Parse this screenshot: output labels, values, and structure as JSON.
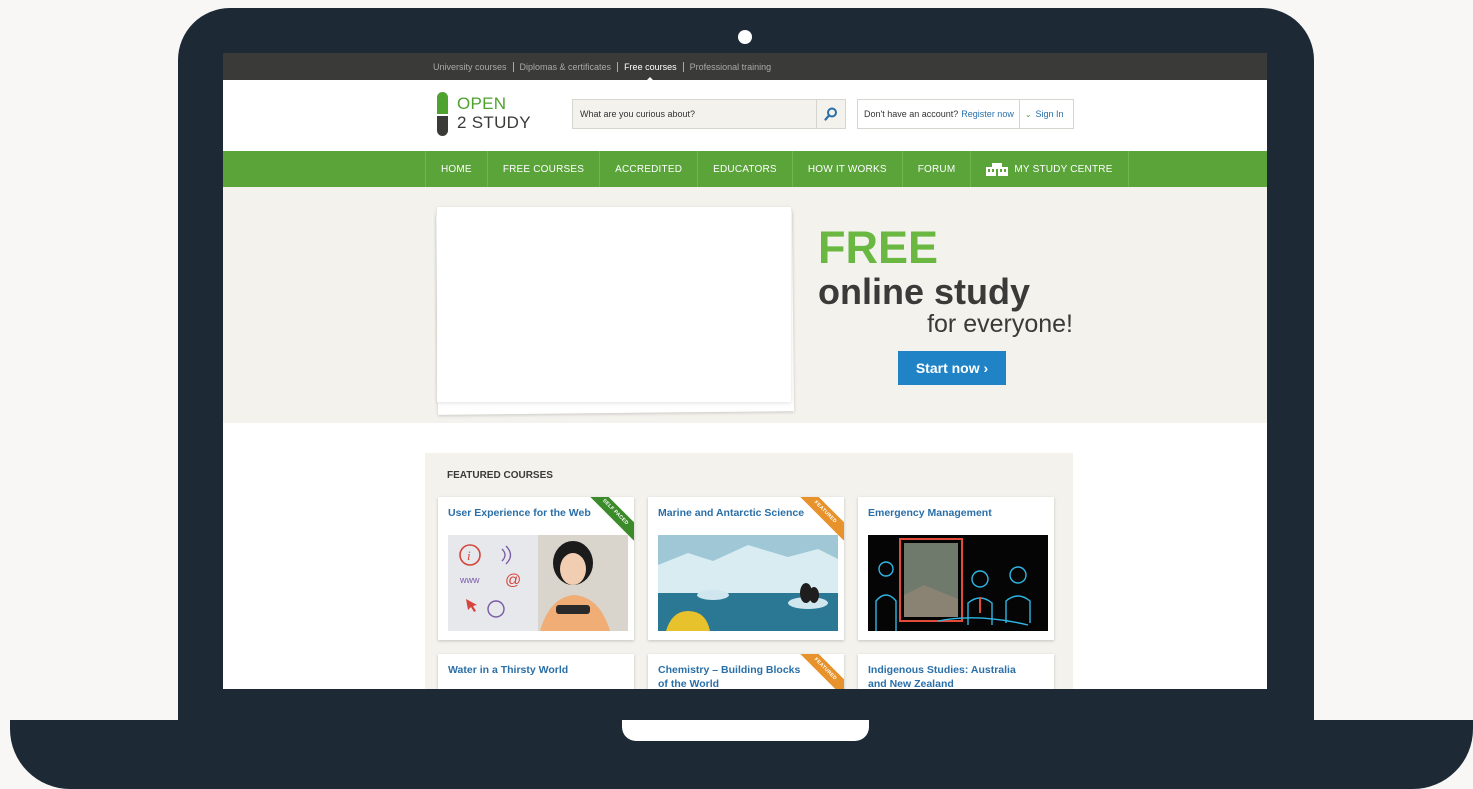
{
  "topbar": {
    "links": [
      {
        "label": "University courses",
        "active": false
      },
      {
        "label": "Diplomas & certificates",
        "active": false
      },
      {
        "label": "Free courses",
        "active": true
      },
      {
        "label": "Professional training",
        "active": false
      }
    ]
  },
  "brand": {
    "line1": "OPEN",
    "line2": "2 STUDY",
    "green": "#4fa22f",
    "dark": "#3a3a38"
  },
  "search": {
    "placeholder": "What are you curious about?",
    "icon": "search-icon"
  },
  "account": {
    "question": "Don't have an account?",
    "register": "Register now",
    "signin": "Sign In",
    "chevron_icon": "chevron-down-icon"
  },
  "nav": {
    "items": [
      "HOME",
      "FREE COURSES",
      "ACCREDITED",
      "EDUCATORS",
      "HOW IT WORKS",
      "FORUM",
      "MY STUDY CENTRE"
    ],
    "study_centre_icon": "building-icon",
    "color": "#5aa43a"
  },
  "hero": {
    "line1": "FREE",
    "line2": "online study",
    "line3": "for everyone!",
    "cta": "Start now ›",
    "cta_color": "#1f83c6"
  },
  "featured": {
    "title": "FEATURED COURSES",
    "courses": [
      {
        "title": "User Experience for the Web",
        "ribbon": "SELF PACED"
      },
      {
        "title": "Marine and Antarctic Science",
        "ribbon": "FEATURED"
      },
      {
        "title": "Emergency Management",
        "ribbon": ""
      },
      {
        "title": "Water in a Thirsty World",
        "ribbon": ""
      },
      {
        "title": "Chemistry – Building Blocks of the World",
        "ribbon": "FEATURED"
      },
      {
        "title": "Indigenous Studies: Australia and New Zealand",
        "ribbon": ""
      }
    ]
  }
}
